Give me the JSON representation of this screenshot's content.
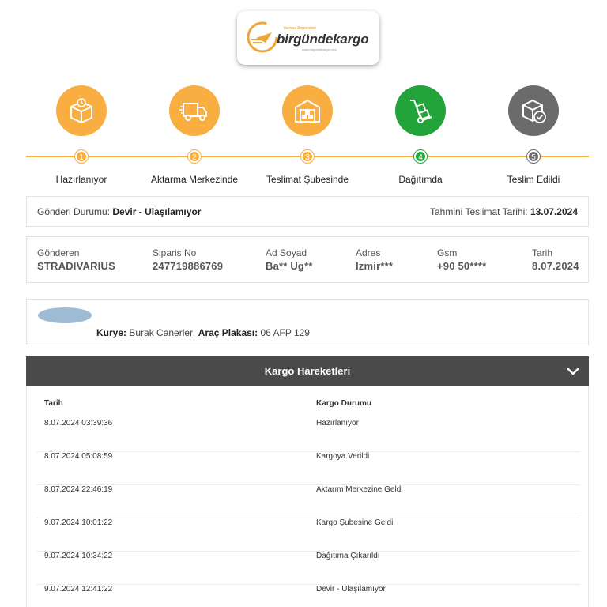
{
  "brand": {
    "tagline": "Yarınsa Birgündeki",
    "name_part1": "birgünde",
    "name_part2": "kargo",
    "url": "www.birgundekargo.com"
  },
  "colors": {
    "accent": "#f9ae42",
    "done": "#f9ae42",
    "active": "#22a43b",
    "pending": "#6b6b6b",
    "header_bg": "#4a4a4a"
  },
  "steps": [
    {
      "number": "1",
      "label": "Hazırlanıyor",
      "icon": "box-timer-icon",
      "state": "done"
    },
    {
      "number": "2",
      "label": "Aktarma Merkezinde",
      "icon": "truck-icon",
      "state": "done"
    },
    {
      "number": "3",
      "label": "Teslimat Şubesinde",
      "icon": "warehouse-icon",
      "state": "done"
    },
    {
      "number": "4",
      "label": "Dağıtımda",
      "icon": "hand-truck-icon",
      "state": "active"
    },
    {
      "number": "5",
      "label": "Teslim Edildi",
      "icon": "package-check-icon",
      "state": "pending"
    }
  ],
  "status": {
    "label": "Gönderi Durumu:",
    "value": "Devir - Ulaşılamıyor",
    "eta_label": "Tahmini Teslimat Tarihi:",
    "eta_value": "13.07.2024"
  },
  "shipment": {
    "sender_label": "Gönderen",
    "sender_value": "STRADIVARIUS",
    "order_label": "Siparis No",
    "order_value": "247719886769",
    "name_label": "Ad Soyad",
    "name_value": "Ba** Ug**",
    "address_label": "Adres",
    "address_value": "Izmir***",
    "gsm_label": "Gsm",
    "gsm_value": "+90 50****",
    "date_label": "Tarih",
    "date_value": "8.07.2024"
  },
  "courier": {
    "courier_label": "Kurye:",
    "courier_value": "Burak Canerler",
    "plate_label": "Araç Plakası:",
    "plate_value": "06 AFP 129"
  },
  "movements": {
    "title": "Kargo Hareketleri",
    "col_date": "Tarih",
    "col_status": "Kargo Durumu",
    "rows": [
      {
        "date": "8.07.2024 03:39:36",
        "status": "Hazırlanıyor"
      },
      {
        "date": "8.07.2024 05:08:59",
        "status": "Kargoya Verildi"
      },
      {
        "date": "8.07.2024 22:46:19",
        "status": "Aktarım Merkezine Geldi"
      },
      {
        "date": "9.07.2024 10:01:22",
        "status": "Kargo Şubesine Geldi"
      },
      {
        "date": "9.07.2024 10:34:22",
        "status": "Dağıtıma Çıkarıldı"
      },
      {
        "date": "9.07.2024 12:41:22",
        "status": "Devir - Ulaşılamıyor"
      }
    ]
  }
}
